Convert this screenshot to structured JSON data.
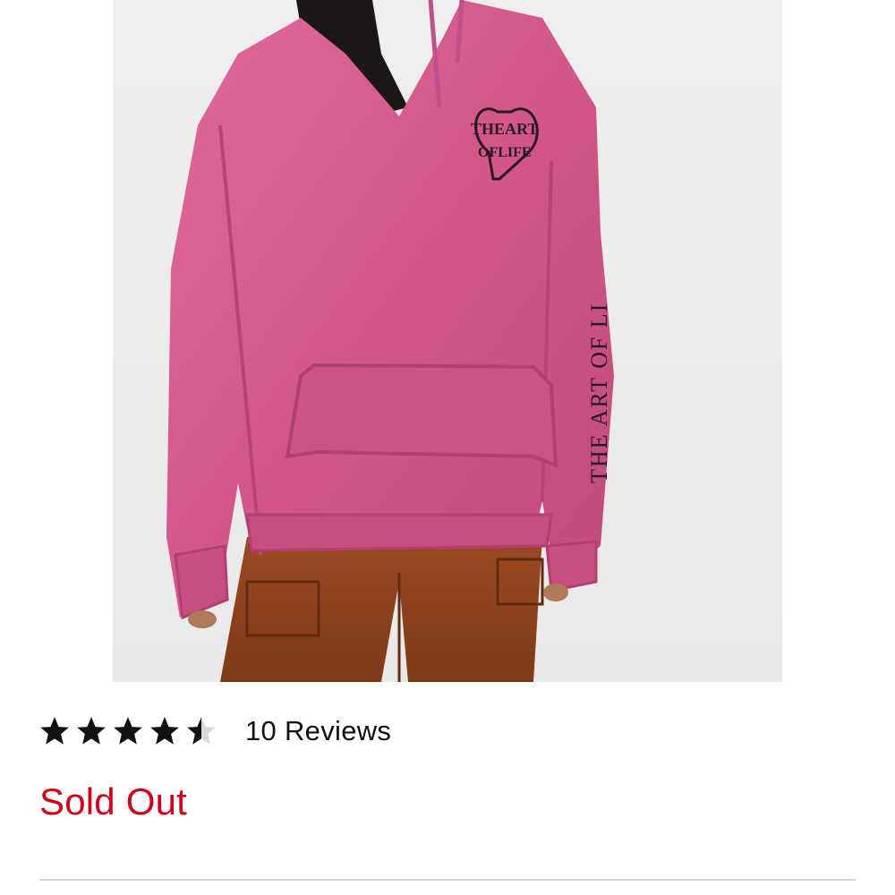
{
  "product": {
    "image_name": "pink-graphic-hoodie-photo",
    "graphic_text": "THE ART OF LIFE"
  },
  "rating": {
    "value": 4.5,
    "max": 5,
    "reviews_label": "10 Reviews"
  },
  "availability": {
    "status": "Sold Out",
    "color": "#d0021b"
  }
}
